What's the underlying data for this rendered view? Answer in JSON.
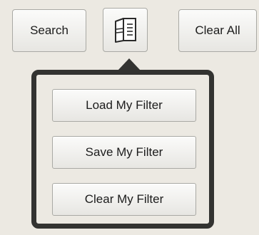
{
  "toolbar": {
    "search_label": "Search",
    "filter_menu_icon": "document-list-icon",
    "clear_all_label": "Clear All"
  },
  "filter_menu": {
    "items": [
      {
        "label": "Load My Filter"
      },
      {
        "label": "Save My Filter"
      },
      {
        "label": "Clear My Filter"
      }
    ]
  },
  "colors": {
    "background": "#ece9e2",
    "popup_border": "#333331",
    "button_border": "#a9a9a4",
    "text": "#1c1c1c"
  }
}
